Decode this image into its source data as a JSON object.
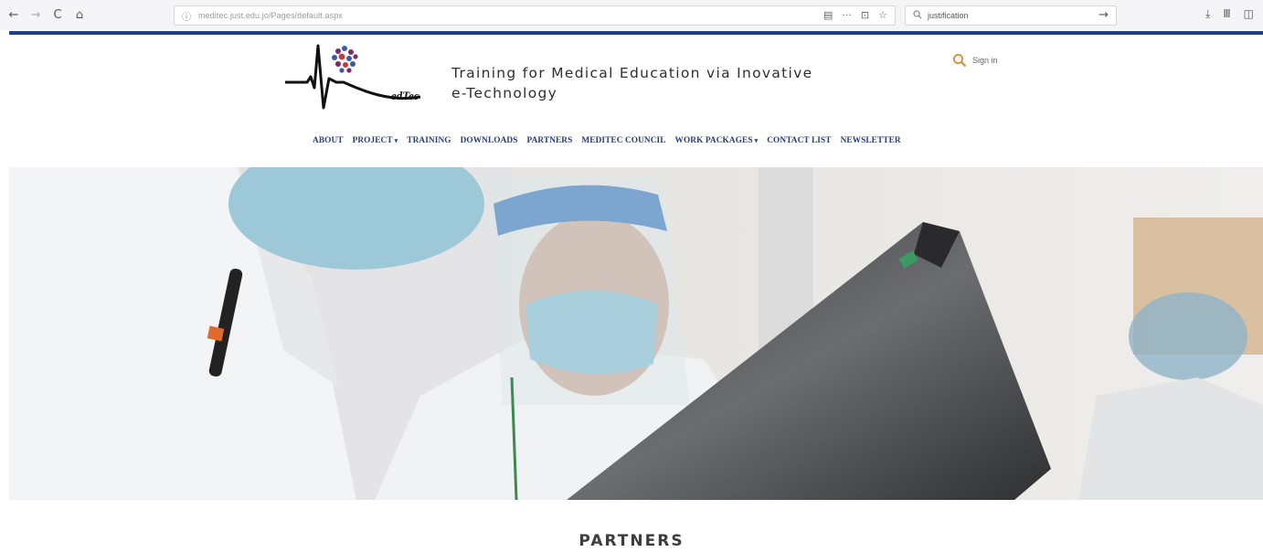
{
  "browser": {
    "back_icon": "←",
    "forward_icon": "→",
    "reload_icon": "C",
    "home_icon": "⌂",
    "url_info_icon": "ⓘ",
    "url": "meditec.just.edu.jo/Pages/default.aspx",
    "reader_icon": "▤",
    "more_icon": "···",
    "pocket_icon": "⊡",
    "bookmark_icon": "☆",
    "search_icon": "🔍",
    "search_query": "justification",
    "search_go_icon": "→",
    "download_icon": "⤓",
    "library_icon": "Ⅲ",
    "sidebar_icon": "◫"
  },
  "site": {
    "logo_text": "edTec",
    "tagline_line1": "Training for Medical Education via Inovative",
    "tagline_line2": "e-Technology",
    "signin_label": "Sign in",
    "nav": [
      {
        "label": "ABOUT",
        "dropdown": false
      },
      {
        "label": "PROJECT",
        "dropdown": true
      },
      {
        "label": "TRAINING",
        "dropdown": false
      },
      {
        "label": "DOWNLOADS",
        "dropdown": false
      },
      {
        "label": "PARTNERS",
        "dropdown": false
      },
      {
        "label": "MEDITEC COUNCIL",
        "dropdown": false
      },
      {
        "label": "WORK PACKAGES",
        "dropdown": true
      },
      {
        "label": "CONTACT LIST",
        "dropdown": false
      },
      {
        "label": "NEWSLETTER",
        "dropdown": false
      }
    ],
    "caret_glyph": "▾",
    "section_title": "PARTNERS"
  },
  "colors": {
    "brand_blue": "#1d3f86",
    "nav_text": "#23407f",
    "signin_icon": "#e08a2a"
  }
}
